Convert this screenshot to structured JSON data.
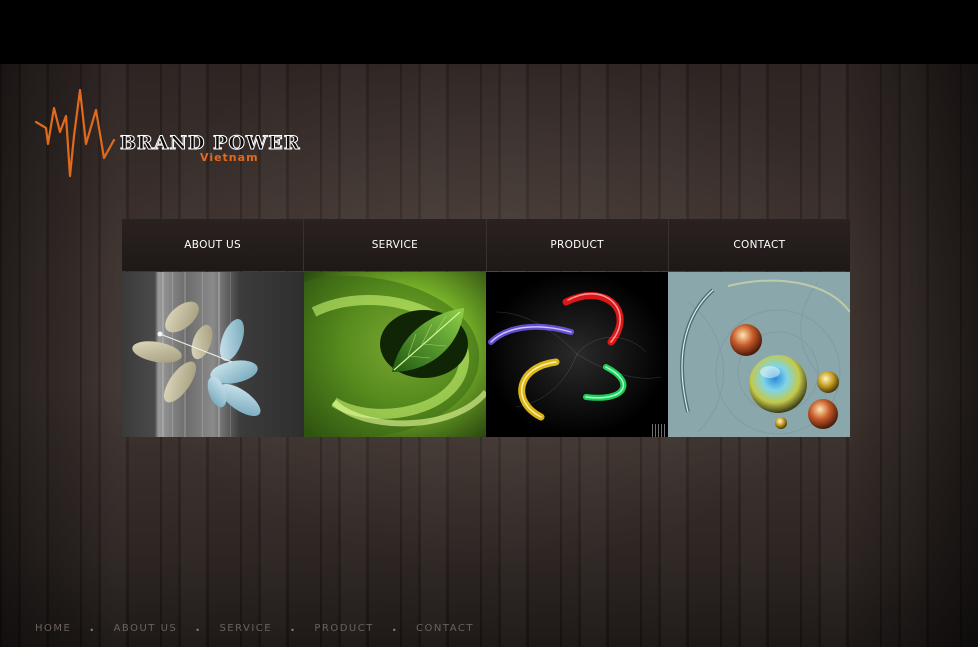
{
  "logo": {
    "name": "BRAND POWER",
    "sub": "Vietnam",
    "accent_color": "#e26a1c"
  },
  "nav": {
    "items": [
      {
        "label": "ABOUT US"
      },
      {
        "label": "SERVICE"
      },
      {
        "label": "PRODUCT"
      },
      {
        "label": "CONTACT"
      }
    ]
  },
  "tiles": [
    {
      "subject": "leaves"
    },
    {
      "subject": "green-swirl-leaf"
    },
    {
      "subject": "light-spiral"
    },
    {
      "subject": "glass-spheres"
    }
  ],
  "footer": {
    "links": [
      "HOME",
      "ABOUT US",
      "SERVICE",
      "PRODUCT",
      "CONTACT"
    ],
    "separator": "•"
  }
}
